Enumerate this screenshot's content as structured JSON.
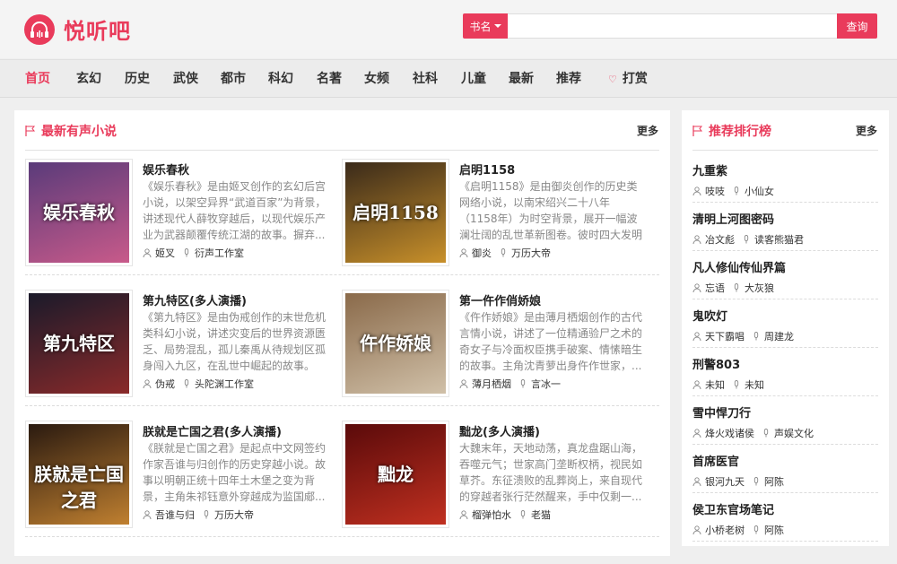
{
  "brand": {
    "name": "悦听吧",
    "accent": "#e93b5b"
  },
  "search": {
    "type_label": "书名",
    "placeholder": "",
    "button": "查询"
  },
  "nav": [
    "首页",
    "玄幻",
    "历史",
    "武侠",
    "都市",
    "科幻",
    "名著",
    "女频",
    "社科",
    "儿童",
    "最新",
    "推荐",
    "打赏"
  ],
  "latest": {
    "title": "最新有声小说",
    "more": "更多",
    "books": [
      {
        "title": "娱乐春秋",
        "desc": "《娱乐春秋》是由姬叉创作的玄幻后宫小说，以架空异界“武道百家”为背景，讲述现代人薛牧穿越后，以现代娱乐产业为武器颠覆传统江湖的故事。摒弃...",
        "author": "姬叉",
        "narrator": "衍声工作室",
        "cover_text": "娱乐春秋",
        "cover_colors": [
          "#5a3b7a",
          "#c85a8a"
        ]
      },
      {
        "title": "启明1158",
        "desc": "《启明1158》是由御炎创作的历史类网络小说，以南宋绍兴二十八年（1158年）为时空背景，展开一幅波澜壮阔的乱世革新图卷。彼时四大发明已成熟...",
        "author": "御炎",
        "narrator": "万历大帝",
        "cover_text": "启明1158",
        "cover_colors": [
          "#3a2a1a",
          "#c8902a"
        ]
      },
      {
        "title": "第九特区(多人演播)",
        "desc": "《第九特区》是由伪戒创作的末世危机类科幻小说，讲述灾变后的世界资源匮乏、局势混乱，孤儿秦禹从待规划区孤身闯入九区，在乱世中崛起的故事。影...",
        "author": "伪戒",
        "narrator": "头陀渊工作室",
        "cover_text": "第九特区",
        "cover_colors": [
          "#1a1a2a",
          "#8a2a2a"
        ]
      },
      {
        "title": "第一仵作俏娇娘",
        "desc": "《仵作娇娘》是由薄月栖烟创作的古代言情小说，讲述了一位精通验尸之术的奇女子与冷面权臣携手破案、情愫暗生的故事。主角沈青萝出身仵作世家，...",
        "author": "薄月栖烟",
        "narrator": "言冰一",
        "cover_text": "仵作娇娘",
        "cover_colors": [
          "#8a6a4a",
          "#d0c0a8"
        ]
      },
      {
        "title": "朕就是亡国之君(多人演播)",
        "desc": "《朕就是亡国之君》是起点中文网签约作家吾谁与归创作的历史穿越小说。故事以明朝正统十四年土木堡之变为背景，主角朱祁钰意外穿越成为监国郕...",
        "author": "吾谁与归",
        "narrator": "万历大帝",
        "cover_text": "朕就是亡国之君",
        "cover_colors": [
          "#2a1a10",
          "#c08030"
        ]
      },
      {
        "title": "黜龙(多人演播)",
        "desc": "大魏末年，天地动荡，真龙盘踞山海，吞噬元气；世家高门垄断权柄，视民如草芥。东征溃败的乱葬岗上，来自现代的穿越者张行茫然醒来，手中仅剩一...",
        "author": "榴弹怕水",
        "narrator": "老猫",
        "cover_text": "黜龙",
        "cover_colors": [
          "#5a0a0a",
          "#c03020"
        ]
      }
    ]
  },
  "ranking": {
    "title": "推荐排行榜",
    "more": "更多",
    "items": [
      {
        "title": "九重紫",
        "author": "吱吱",
        "narrator": "小仙女"
      },
      {
        "title": "清明上河图密码",
        "author": "冶文彪",
        "narrator": "读客熊猫君"
      },
      {
        "title": "凡人修仙传仙界篇",
        "author": "忘语",
        "narrator": "大灰狼"
      },
      {
        "title": "鬼吹灯",
        "author": "天下霸唱",
        "narrator": "周建龙"
      },
      {
        "title": "刑警803",
        "author": "未知",
        "narrator": "未知"
      },
      {
        "title": "雪中悍刀行",
        "author": "烽火戏诸侯",
        "narrator": "声娱文化"
      },
      {
        "title": "首席医官",
        "author": "银河九天",
        "narrator": "阿陈"
      },
      {
        "title": "侯卫东官场笔记",
        "author": "小桥老树",
        "narrator": "阿陈"
      }
    ]
  }
}
